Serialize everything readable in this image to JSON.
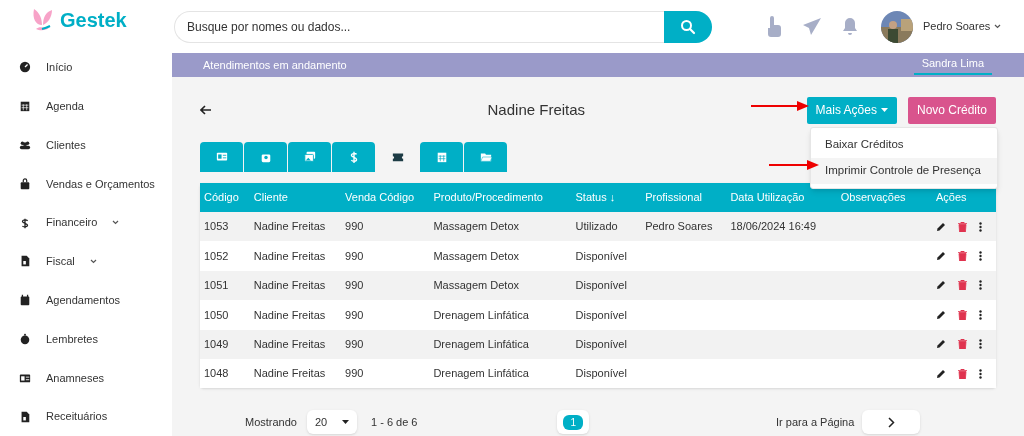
{
  "logo": {
    "text": "Gestek"
  },
  "search": {
    "placeholder": "Busque por nomes ou dados..."
  },
  "user": {
    "name": "Pedro Soares"
  },
  "sidebar": {
    "items": [
      {
        "label": "Início",
        "expandable": false
      },
      {
        "label": "Agenda",
        "expandable": false
      },
      {
        "label": "Clientes",
        "expandable": false
      },
      {
        "label": "Vendas e Orçamentos",
        "expandable": false
      },
      {
        "label": "Financeiro",
        "expandable": true
      },
      {
        "label": "Fiscal",
        "expandable": true
      },
      {
        "label": "Agendamentos",
        "expandable": false
      },
      {
        "label": "Lembretes",
        "expandable": false
      },
      {
        "label": "Anamneses",
        "expandable": false
      },
      {
        "label": "Receituários",
        "expandable": false
      }
    ]
  },
  "banner": {
    "title": "Atendimentos em andamento",
    "tabs": [
      {
        "label": "Sandra Lima",
        "selected": true
      }
    ]
  },
  "page_title": "Nadine Freitas",
  "actions": {
    "more": "Mais Ações",
    "new": "Novo Crédito",
    "menu": [
      "Baixar Créditos",
      "Imprimir Controle de Presença"
    ]
  },
  "tabs": [
    {
      "selected": false
    },
    {
      "selected": false
    },
    {
      "selected": false
    },
    {
      "selected": false
    },
    {
      "selected": true
    },
    {
      "selected": false
    },
    {
      "selected": false
    }
  ],
  "table": {
    "columns": [
      "Código",
      "Cliente",
      "Venda Código",
      "Produto/Procedimento",
      "Status ↓",
      "Profissional",
      "Data Utilização",
      "Observações",
      "Ações"
    ],
    "rows": [
      [
        "1053",
        "Nadine Freitas",
        "990",
        "Massagem Detox",
        "Utilizado",
        "Pedro Soares",
        "18/06/2024 16:49"
      ],
      [
        "1052",
        "Nadine Freitas",
        "990",
        "Massagem Detox",
        "Disponível",
        "",
        ""
      ],
      [
        "1051",
        "Nadine Freitas",
        "990",
        "Massagem Detox",
        "Disponível",
        "",
        ""
      ],
      [
        "1050",
        "Nadine Freitas",
        "990",
        "Drenagem Linfática",
        "Disponível",
        "",
        ""
      ],
      [
        "1049",
        "Nadine Freitas",
        "990",
        "Drenagem Linfática",
        "Disponível",
        "",
        ""
      ],
      [
        "1048",
        "Nadine Freitas",
        "990",
        "Drenagem Linfática",
        "Disponível",
        "",
        ""
      ]
    ]
  },
  "pagination": {
    "showing_label": "Mostrando",
    "page_size": "20",
    "range": "1 - 6 de 6",
    "pages": [
      {
        "label": "1",
        "selected": true
      }
    ],
    "goto_label": "Ir para a Página"
  }
}
